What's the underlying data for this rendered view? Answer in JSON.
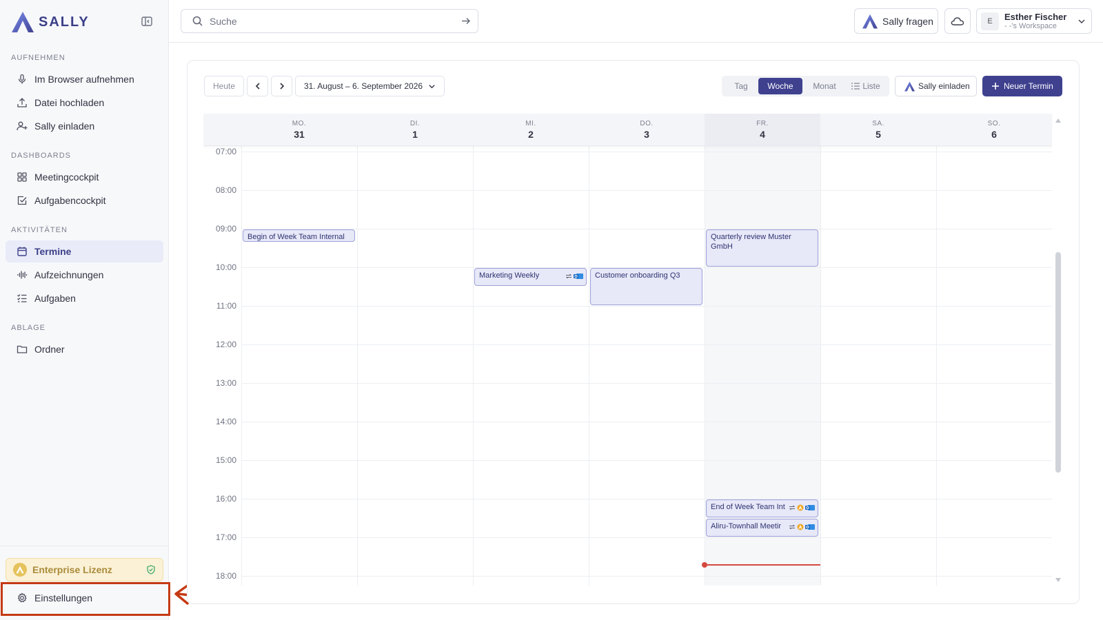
{
  "brand": {
    "name": "SALLY",
    "color": "#3f418f"
  },
  "sidebar": {
    "sections": [
      {
        "label": "AUFNEHMEN",
        "items": [
          {
            "label": "Im Browser aufnehmen",
            "icon": "microphone-icon"
          },
          {
            "label": "Datei hochladen",
            "icon": "upload-icon"
          },
          {
            "label": "Sally einladen",
            "icon": "user-plus-icon"
          }
        ]
      },
      {
        "label": "DASHBOARDS",
        "items": [
          {
            "label": "Meetingcockpit",
            "icon": "grid-icon"
          },
          {
            "label": "Aufgabencockpit",
            "icon": "checkbox-icon"
          }
        ]
      },
      {
        "label": "AKTIVITÄTEN",
        "items": [
          {
            "label": "Termine",
            "icon": "calendar-icon",
            "active": true
          },
          {
            "label": "Aufzeichnungen",
            "icon": "waveform-icon"
          },
          {
            "label": "Aufgaben",
            "icon": "task-list-icon"
          }
        ]
      },
      {
        "label": "ABLAGE",
        "items": [
          {
            "label": "Ordner",
            "icon": "folder-icon"
          }
        ]
      }
    ],
    "license": "Enterprise Lizenz",
    "settings": "Einstellungen"
  },
  "topbar": {
    "search_placeholder": "Suche",
    "ask_label": "Sally fragen",
    "user": {
      "initial": "E",
      "name": "Esther Fischer",
      "workspace": "- -'s Workspace"
    }
  },
  "toolbar": {
    "today": "Heute",
    "date_range": "31. August – 6. September 2026",
    "views": [
      "Tag",
      "Woche",
      "Monat",
      "Liste"
    ],
    "active_view": "Woche",
    "invite": "Sally einladen",
    "new_event": "Neuer Termin"
  },
  "calendar": {
    "days": [
      {
        "dow": "MO.",
        "num": "31"
      },
      {
        "dow": "DI.",
        "num": "1"
      },
      {
        "dow": "MI.",
        "num": "2"
      },
      {
        "dow": "DO.",
        "num": "3"
      },
      {
        "dow": "FR.",
        "num": "4",
        "today": true
      },
      {
        "dow": "SA.",
        "num": "5"
      },
      {
        "dow": "SO.",
        "num": "6"
      }
    ],
    "hours": [
      "07:00",
      "08:00",
      "09:00",
      "10:00",
      "11:00",
      "12:00",
      "13:00",
      "14:00",
      "15:00",
      "16:00",
      "17:00",
      "18:00"
    ],
    "events": [
      {
        "title": "Begin of Week Team Internal",
        "day": 0,
        "start": 9.0,
        "end": 9.35,
        "icons": []
      },
      {
        "title": "Marketing Weekly",
        "day": 2,
        "start": 10.0,
        "end": 10.5,
        "icons": [
          "recurring-icon",
          "outlook-icon"
        ]
      },
      {
        "title": "Customer onboarding Q3",
        "day": 3,
        "start": 10.0,
        "end": 11.0,
        "icons": []
      },
      {
        "title": "Quarterly review Muster GmbH",
        "day": 4,
        "start": 9.0,
        "end": 10.0,
        "icons": []
      },
      {
        "title": "End of Week Team Int",
        "day": 4,
        "start": 16.0,
        "end": 16.5,
        "icons": [
          "recurring-icon",
          "sally-bot-icon",
          "outlook-icon"
        ]
      },
      {
        "title": "Aliru-Townhall Meetir",
        "day": 4,
        "start": 16.5,
        "end": 17.0,
        "icons": [
          "recurring-icon",
          "sally-bot-icon",
          "outlook-icon"
        ]
      }
    ],
    "now_hour": 17.7
  }
}
